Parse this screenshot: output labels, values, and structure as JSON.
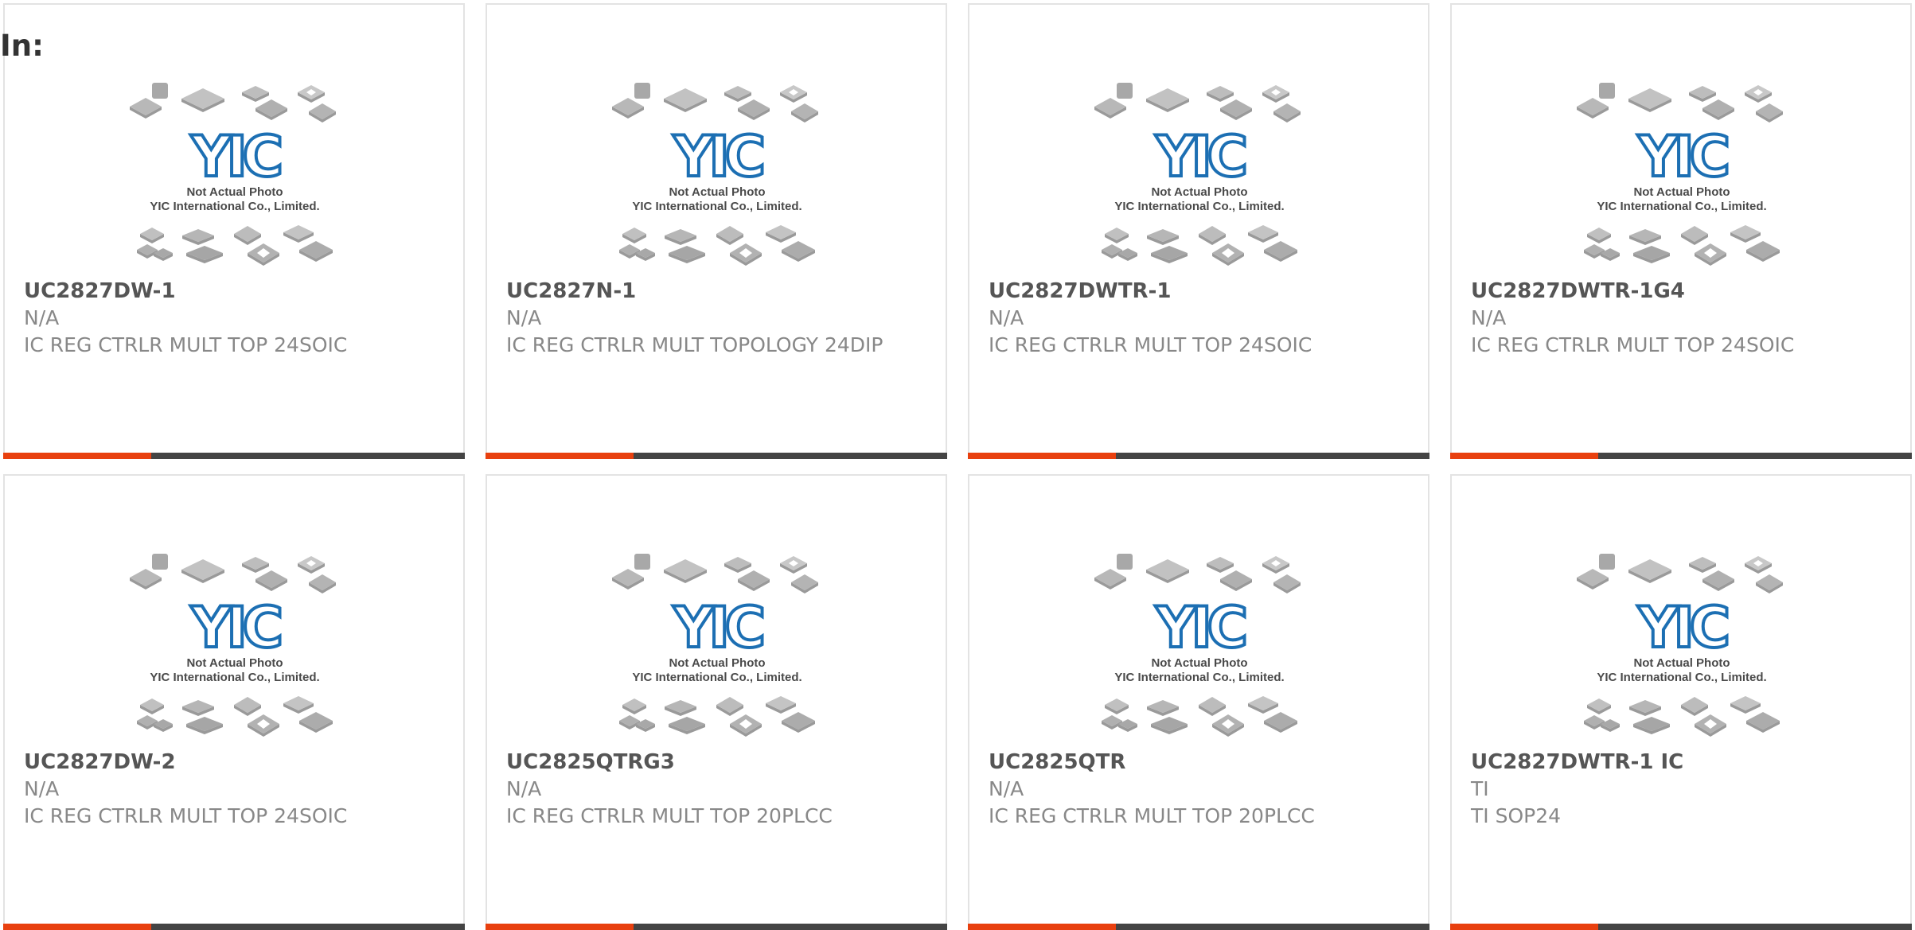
{
  "heading": "In:",
  "placeholder": {
    "line1": "Not Actual Photo",
    "line2": "YIC International Co., Limited.",
    "logo": "YIC"
  },
  "colors": {
    "accent": "#e8400f",
    "bar": "#444444",
    "logo": "#1c6fb3",
    "chip": "#b8b8b8"
  },
  "bar_accent_fraction": 0.32,
  "products": [
    {
      "part": "UC2827DW-1",
      "manufacturer": "N/A",
      "description": "IC REG CTRLR MULT TOP 24SOIC"
    },
    {
      "part": "UC2827N-1",
      "manufacturer": "N/A",
      "description": "IC REG CTRLR MULT TOPOLOGY 24DIP"
    },
    {
      "part": "UC2827DWTR-1",
      "manufacturer": "N/A",
      "description": "IC REG CTRLR MULT TOP 24SOIC"
    },
    {
      "part": "UC2827DWTR-1G4",
      "manufacturer": "N/A",
      "description": "IC REG CTRLR MULT TOP 24SOIC"
    },
    {
      "part": "UC2827DW-2",
      "manufacturer": "N/A",
      "description": "IC REG CTRLR MULT TOP 24SOIC"
    },
    {
      "part": "UC2825QTRG3",
      "manufacturer": "N/A",
      "description": "IC REG CTRLR MULT TOP 20PLCC"
    },
    {
      "part": "UC2825QTR",
      "manufacturer": "N/A",
      "description": "IC REG CTRLR MULT TOP 20PLCC"
    },
    {
      "part": "UC2827DWTR-1 IC",
      "manufacturer": "TI",
      "description": "TI SOP24"
    }
  ]
}
